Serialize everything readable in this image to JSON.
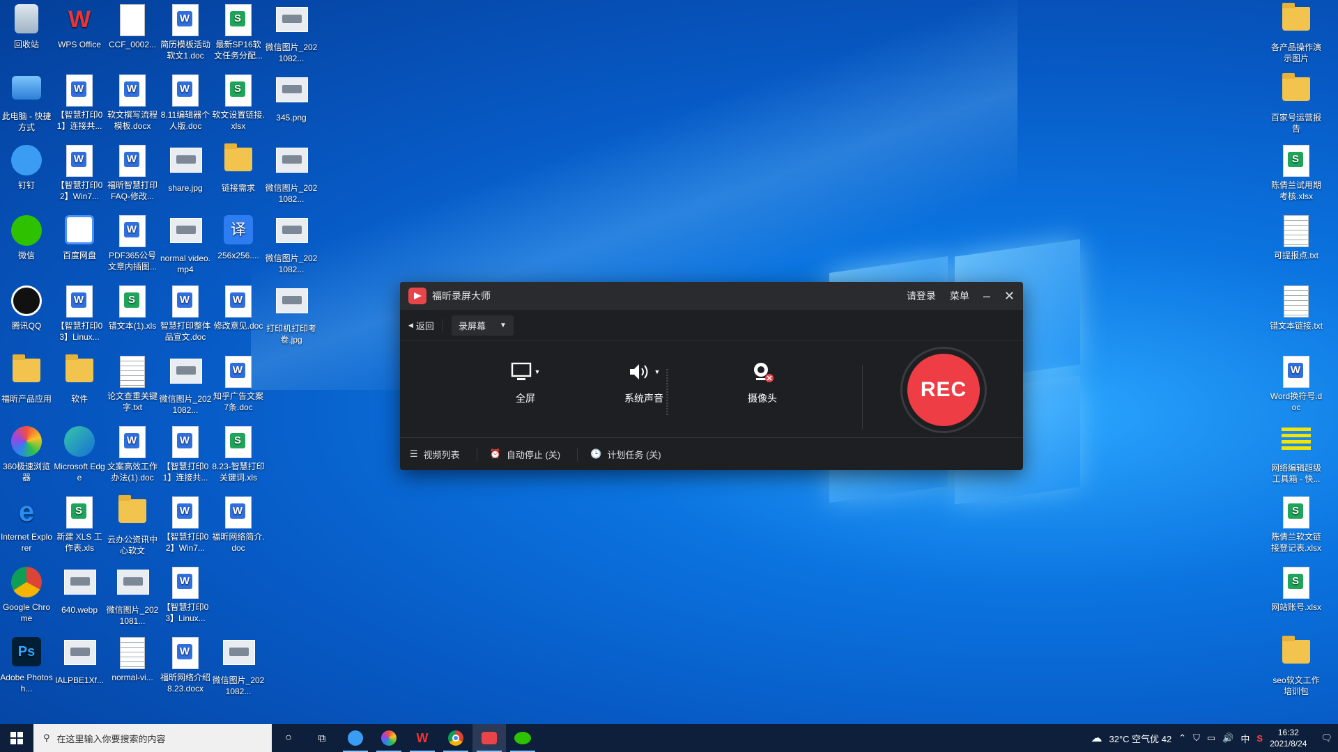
{
  "desktop": {
    "left_icons": [
      {
        "label": "回收站",
        "type": "recycle"
      },
      {
        "label": "WPS Office",
        "type": "wps"
      },
      {
        "label": "CCF_0002...",
        "type": "blank"
      },
      {
        "label": "简历模板活动软文1.doc",
        "type": "w"
      },
      {
        "label": "最新SP16软文任务分配...",
        "type": "s"
      },
      {
        "label": "微信图片_2021082...",
        "type": "img"
      },
      {
        "label": "此电脑 - 快捷方式",
        "type": "pc"
      },
      {
        "label": "【智慧打印01】连接共...",
        "type": "w"
      },
      {
        "label": "软文撰写流程模板.docx",
        "type": "w"
      },
      {
        "label": "8.11编辑器个人版.doc",
        "type": "w"
      },
      {
        "label": "软文设置链接.xlsx",
        "type": "s"
      },
      {
        "label": "345.png",
        "type": "img"
      },
      {
        "label": "钉钉",
        "type": "dingding"
      },
      {
        "label": "【智慧打印02】Win7...",
        "type": "w"
      },
      {
        "label": "福昕智慧打印FAQ-修改...",
        "type": "w"
      },
      {
        "label": "share.jpg",
        "type": "img"
      },
      {
        "label": "链接需求",
        "type": "folder"
      },
      {
        "label": "微信图片_2021082...",
        "type": "img"
      },
      {
        "label": "微信",
        "type": "wechat"
      },
      {
        "label": "百度网盘",
        "type": "baidu"
      },
      {
        "label": "PDF365公号文章内插图...",
        "type": "w"
      },
      {
        "label": "normal video.mp4",
        "type": "video"
      },
      {
        "label": "256x256....",
        "type": "translate"
      },
      {
        "label": "微信图片_2021082...",
        "type": "img"
      },
      {
        "label": "腾讯QQ",
        "type": "qq"
      },
      {
        "label": "【智慧打印03】Linux...",
        "type": "w"
      },
      {
        "label": "错文本(1).xls",
        "type": "s"
      },
      {
        "label": "智慧打印整体品宣文.doc",
        "type": "w"
      },
      {
        "label": "修改意见.doc",
        "type": "w"
      },
      {
        "label": "打印机打印考卷.jpg",
        "type": "img"
      },
      {
        "label": "福昕产品应用",
        "type": "folder"
      },
      {
        "label": "软件",
        "type": "folder"
      },
      {
        "label": "论文查重关键字.txt",
        "type": "txt"
      },
      {
        "label": "微信图片_2021082...",
        "type": "img"
      },
      {
        "label": "知乎广告文案7条.doc",
        "type": "w"
      },
      {
        "label": "",
        "type": "empty"
      },
      {
        "label": "360极速浏览器",
        "type": "360"
      },
      {
        "label": "Microsoft Edge",
        "type": "edge"
      },
      {
        "label": "文案高效工作办法(1).doc",
        "type": "w"
      },
      {
        "label": "【智慧打印01】连接共...",
        "type": "w"
      },
      {
        "label": "8.23-智慧打印关键词.xls",
        "type": "s"
      },
      {
        "label": "",
        "type": "empty"
      },
      {
        "label": "Internet Explorer",
        "type": "ie"
      },
      {
        "label": "新建 XLS 工作表.xls",
        "type": "s"
      },
      {
        "label": "云办公资讯中心软文",
        "type": "folder"
      },
      {
        "label": "【智慧打印02】Win7...",
        "type": "w"
      },
      {
        "label": "福昕网络简介.doc",
        "type": "w"
      },
      {
        "label": "",
        "type": "empty"
      },
      {
        "label": "Google Chrome",
        "type": "chrome"
      },
      {
        "label": "640.webp",
        "type": "img"
      },
      {
        "label": "微信图片_2021081...",
        "type": "img"
      },
      {
        "label": "【智慧打印03】Linux...",
        "type": "w"
      },
      {
        "label": "",
        "type": "empty"
      },
      {
        "label": "",
        "type": "empty"
      },
      {
        "label": "Adobe Photosh...",
        "type": "ps"
      },
      {
        "label": "IALPBE1Xf...",
        "type": "img"
      },
      {
        "label": "normal-vi...",
        "type": "txt"
      },
      {
        "label": "福昕网络介绍8.23.docx",
        "type": "w"
      },
      {
        "label": "微信图片_2021082...",
        "type": "img"
      }
    ],
    "right_icons": [
      {
        "label": "各产品操作演示图片",
        "type": "folder"
      },
      {
        "label": "百家号运营报告",
        "type": "folder"
      },
      {
        "label": "陈倩兰试用期考核.xlsx",
        "type": "s"
      },
      {
        "label": "可提报点.txt",
        "type": "txt"
      },
      {
        "label": "错文本链接.txt",
        "type": "txt"
      },
      {
        "label": "Word换符号.doc",
        "type": "w"
      },
      {
        "label": "网络编辑超级工具箱 - 快...",
        "type": "tool"
      },
      {
        "label": "陈倩兰软文链接登记表.xlsx",
        "type": "s"
      },
      {
        "label": "网站账号.xlsx",
        "type": "s"
      },
      {
        "label": "seo软文工作培训包",
        "type": "folder"
      }
    ]
  },
  "recorder": {
    "title": "福昕录屏大师",
    "login": "请登录",
    "menu": "菜单",
    "back": "返回",
    "mode": "录屏幕",
    "fullscreen": "全屏",
    "system_audio": "系统声音",
    "camera": "摄像头",
    "rec": "REC",
    "video_list": "视频列表",
    "auto_stop": "自动停止 (关)",
    "schedule": "计划任务 (关)"
  },
  "taskbar": {
    "search_placeholder": "在这里输入你要搜索的内容",
    "weather": "32°C 空气优 42",
    "ime": "中",
    "time": "16:32",
    "date": "2021/8/24"
  }
}
